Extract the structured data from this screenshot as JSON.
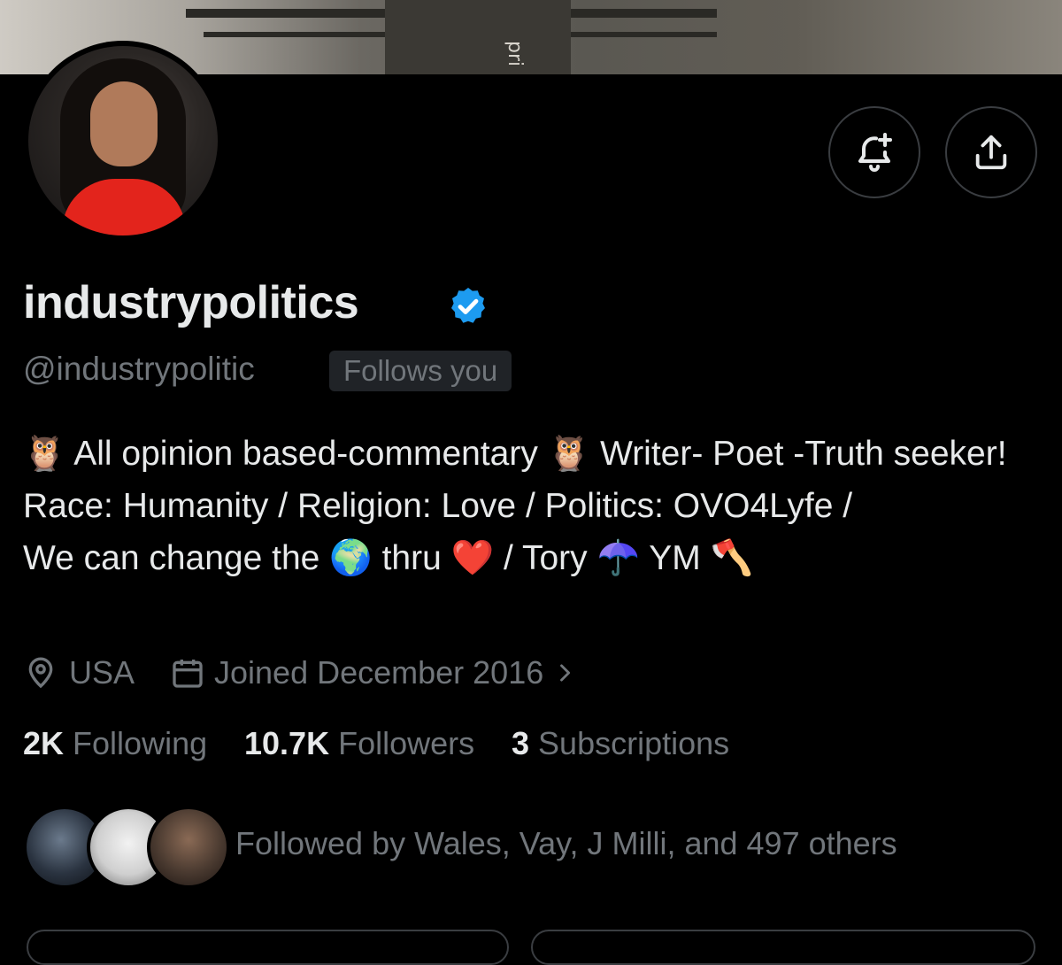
{
  "banner": {
    "image_label": "pri"
  },
  "profile": {
    "display_name": "industrypolitics",
    "handle": "@industrypolitic",
    "follows_you": "Follows you",
    "verified_icon": "verified-badge-icon"
  },
  "actions": {
    "notify_icon": "bell-plus-icon",
    "share_icon": "share-icon"
  },
  "bio": {
    "line1_text_a": " All opinion based-commentary ",
    "line1_text_b": " Writer- Poet -Truth seeker!",
    "line2": "Race: Humanity / Religion: Love / Politics: OVO4Lyfe / ",
    "line3_a": "We can change the ",
    "line3_b": " thru ",
    "line3_c": " / Tory ",
    "line3_d": " YM ",
    "emoji": {
      "owl": "🦉",
      "globe": "🌍",
      "heart": "❤️",
      "umbrella": "☂️",
      "axe": "🪓"
    }
  },
  "meta": {
    "location_icon": "location-pin-icon",
    "location": "USA",
    "calendar_icon": "calendar-icon",
    "joined": "Joined December 2016",
    "chevron_icon": "chevron-right-icon"
  },
  "stats": {
    "following_count": "2K",
    "following_label": "Following",
    "followers_count": "10.7K",
    "followers_label": "Followers",
    "subscriptions_count": "3",
    "subscriptions_label": "Subscriptions"
  },
  "followed_by": {
    "text": "Followed by Wales, Vay, J Milli, and 497 others"
  },
  "colors": {
    "background": "#000000",
    "primary_text": "#e7e9ea",
    "secondary_text": "#71767b",
    "verified_blue": "#1d9bf0",
    "button_border": "#3a3d41"
  }
}
